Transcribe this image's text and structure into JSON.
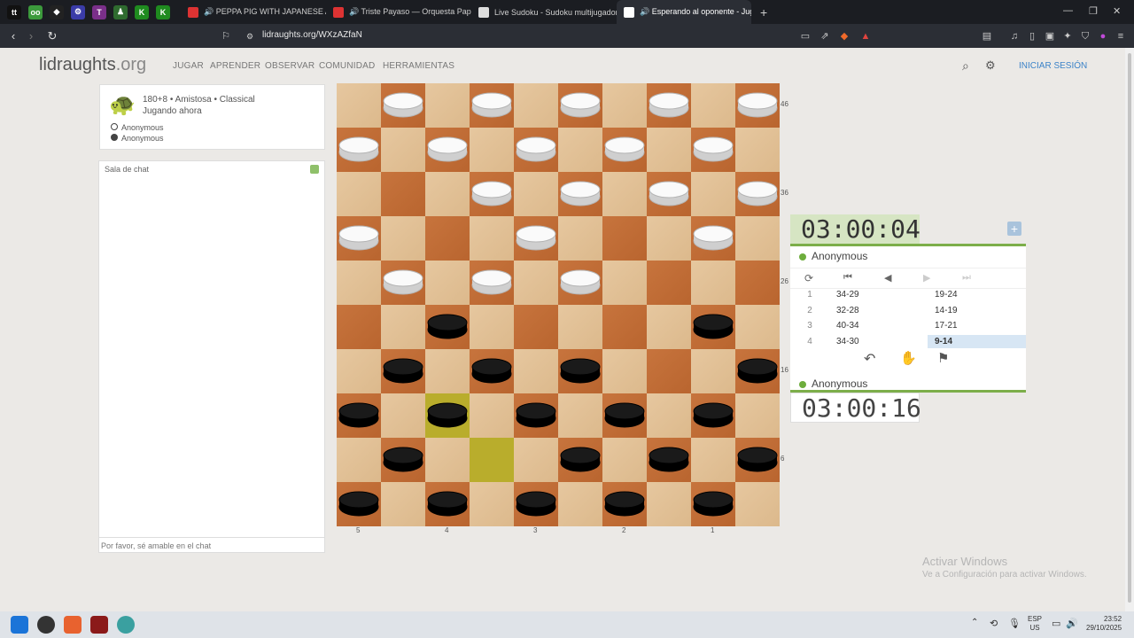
{
  "browser": {
    "pinned": [
      {
        "label": "tt",
        "color": "#111"
      },
      {
        "label": "oo",
        "color": "#3c9a3c"
      },
      {
        "label": "◆",
        "color": "#222"
      },
      {
        "label": "⚙",
        "color": "#3b3ca8"
      },
      {
        "label": "T",
        "color": "#7a2f8a"
      },
      {
        "label": "♟",
        "color": "#2f6b2f"
      },
      {
        "label": "K",
        "color": "#1f8b1f"
      },
      {
        "label": "K",
        "color": "#1f8b1f"
      }
    ],
    "tabs": [
      {
        "title": "🔊 PEPPA PIG WITH JAPANESE AND E",
        "fav": "#d33"
      },
      {
        "title": "🔊 Triste Payaso — Orquesta Papilon",
        "fav": "#d33"
      },
      {
        "title": "Live Sudoku - Sudoku multijugador",
        "fav": "#ddd"
      },
      {
        "title": "🔊 Esperando al oponente - Juga",
        "fav": "#fff",
        "active": true
      }
    ],
    "url": "lidraughts.org/WXzAZfaN"
  },
  "site": {
    "logo_main": "lidraughts",
    "logo_tld": ".org",
    "nav": [
      "JUGAR",
      "APRENDER",
      "OBSERVAR",
      "COMUNIDAD",
      "HERRAMIENTAS"
    ],
    "login": "INICIAR SESIÓN"
  },
  "game": {
    "type": "180+8 • Amistosa • Classical",
    "status": "Jugando ahora",
    "white_player": "Anonymous",
    "black_player": "Anonymous"
  },
  "chat": {
    "title": "Sala de chat",
    "placeholder": "Por favor, sé amable en el chat"
  },
  "board": {
    "white_pieces": [
      [
        0,
        1
      ],
      [
        0,
        3
      ],
      [
        0,
        5
      ],
      [
        0,
        7
      ],
      [
        0,
        9
      ],
      [
        1,
        0
      ],
      [
        1,
        2
      ],
      [
        1,
        4
      ],
      [
        1,
        6
      ],
      [
        1,
        8
      ],
      [
        2,
        3
      ],
      [
        2,
        5
      ],
      [
        2,
        7
      ],
      [
        2,
        9
      ],
      [
        3,
        0
      ],
      [
        3,
        4
      ],
      [
        3,
        8
      ],
      [
        4,
        1
      ],
      [
        4,
        3
      ],
      [
        4,
        5
      ]
    ],
    "black_pieces": [
      [
        5,
        2
      ],
      [
        5,
        8
      ],
      [
        6,
        1
      ],
      [
        6,
        3
      ],
      [
        6,
        5
      ],
      [
        6,
        9
      ],
      [
        7,
        0
      ],
      [
        7,
        2
      ],
      [
        7,
        4
      ],
      [
        7,
        6
      ],
      [
        7,
        8
      ],
      [
        8,
        1
      ],
      [
        8,
        5
      ],
      [
        8,
        7
      ],
      [
        8,
        9
      ],
      [
        9,
        0
      ],
      [
        9,
        2
      ],
      [
        9,
        4
      ],
      [
        9,
        6
      ],
      [
        9,
        8
      ]
    ],
    "highlighted": [
      [
        7,
        2
      ],
      [
        8,
        3
      ]
    ],
    "right_coords": [
      {
        "row": 0,
        "label": "46"
      },
      {
        "row": 2,
        "label": "36"
      },
      {
        "row": 4,
        "label": "26"
      },
      {
        "row": 6,
        "label": "16"
      },
      {
        "row": 8,
        "label": "6"
      }
    ],
    "bottom_coords": [
      {
        "col": 0,
        "label": "5"
      },
      {
        "col": 2,
        "label": "4"
      },
      {
        "col": 4,
        "label": "3"
      },
      {
        "col": 6,
        "label": "2"
      },
      {
        "col": 8,
        "label": "1"
      }
    ]
  },
  "clocks": {
    "top": "03:00:04",
    "bottom": "03:00:16"
  },
  "players": {
    "top": "Anonymous",
    "bottom": "Anonymous"
  },
  "moves": [
    {
      "n": "1",
      "w": "34-29",
      "b": "19-24"
    },
    {
      "n": "2",
      "w": "32-28",
      "b": "14-19"
    },
    {
      "n": "3",
      "w": "40-34",
      "b": "17-21"
    },
    {
      "n": "4",
      "w": "34-30",
      "b": "9-14"
    }
  ],
  "watermark": {
    "line1": "Activar Windows",
    "line2": "Ve a Configuración para activar Windows."
  },
  "tray": {
    "lang1": "ESP",
    "lang2": "US",
    "time": "23:52",
    "date": "29/10/2025"
  }
}
